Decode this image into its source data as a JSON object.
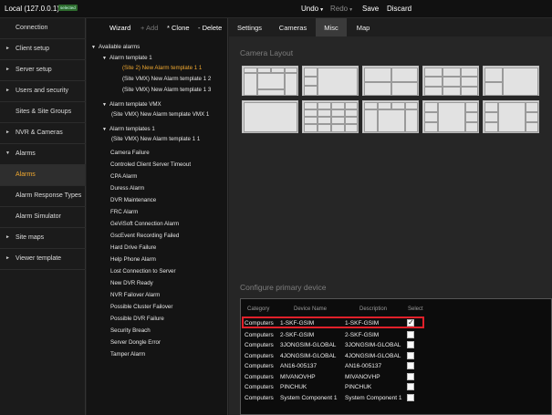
{
  "topbar": {
    "host": "Local (127.0.0.1)",
    "badge": "selected",
    "undo": "Undo",
    "redo": "Redo",
    "save": "Save",
    "discard": "Discard"
  },
  "sidebar": {
    "items": [
      {
        "label": "Connection",
        "arrow": ""
      },
      {
        "label": "Client setup",
        "arrow": "►"
      },
      {
        "label": "Server setup",
        "arrow": "►"
      },
      {
        "label": "Users and security",
        "arrow": "►"
      },
      {
        "label": "Sites & Site Groups",
        "arrow": ""
      },
      {
        "label": "NVR & Cameras",
        "arrow": "►"
      },
      {
        "label": "Alarms",
        "arrow": "▼"
      },
      {
        "label": "Alarms",
        "arrow": ""
      },
      {
        "label": "Alarm Response Types",
        "arrow": ""
      },
      {
        "label": "Alarm Simulator",
        "arrow": ""
      },
      {
        "label": "Site maps",
        "arrow": "►"
      },
      {
        "label": "Viewer template",
        "arrow": "►"
      }
    ]
  },
  "tree_toolbar": {
    "wizard": "Wizard",
    "add": "+ Add",
    "clone": "* Clone",
    "delete": "- Delete"
  },
  "tree": {
    "root": "Available alarms",
    "template1": "Alarm template 1",
    "t1_items": [
      "(Site 2) New Alarm template 1 1",
      "(Site VMX) New Alarm template 1 2",
      "(Site VMX) New Alarm template 1 3"
    ],
    "template_vmx": "Alarm template VMX",
    "vmx_items": [
      "(Site VMX) New Alarm template VMX 1"
    ],
    "templates1": "Alarm templates 1",
    "ts_items": [
      "(Site VMX) New Alarm template 1 1"
    ],
    "alarm_types": [
      "Camera Failure",
      "Controled Client Server Timeout",
      "CPA Alarm",
      "Duress Alarm",
      "DVR Maintenance",
      "FRC Alarm",
      "GeViSoft Connection Alarm",
      "GscEvent Recording Failed",
      "Hard Drive Failure",
      "Help Phone Alarm",
      "Lost Connection to Server",
      "New DVR Ready",
      "NVR Failover Alarm",
      "Possible Cluster Failover",
      "Possible DVR Failure",
      "Security Breach",
      "Server Dongle Error",
      "Tamper Alarm"
    ]
  },
  "tabs": [
    "Settings",
    "Cameras",
    "Misc",
    "Map"
  ],
  "camera_layout": {
    "title": "Camera Layout"
  },
  "device_config": {
    "title": "Configure primary device",
    "headers": {
      "category": "Category",
      "device_name": "Device Name",
      "description": "Description",
      "select": "Select"
    },
    "rows": [
      {
        "category": "Computers",
        "device_name": "1-SKF-GSIM",
        "description": "1-SKF-GSIM",
        "checked": true
      },
      {
        "category": "Computers",
        "device_name": "2-SKF-GSIM",
        "description": "2-SKF-GSIM",
        "checked": false
      },
      {
        "category": "Computers",
        "device_name": "3JONGSIM-GLOBAL",
        "description": "3JONGSIM-GLOBAL",
        "checked": false
      },
      {
        "category": "Computers",
        "device_name": "4JONGSIM-GLOBAL",
        "description": "4JONGSIM-GLOBAL",
        "checked": false
      },
      {
        "category": "Computers",
        "device_name": "AN16-005137",
        "description": "AN16-005137",
        "checked": false
      },
      {
        "category": "Computers",
        "device_name": "MIVANOVHP",
        "description": "MIVANOVHP",
        "checked": false
      },
      {
        "category": "Computers",
        "device_name": "PINCHUK",
        "description": "PINCHUK",
        "checked": false
      },
      {
        "category": "Computers",
        "device_name": "System Component 1",
        "description": "System Component 1",
        "checked": false
      }
    ]
  },
  "colors": {
    "accent": "#f0a830",
    "highlight": "#e0202a"
  }
}
